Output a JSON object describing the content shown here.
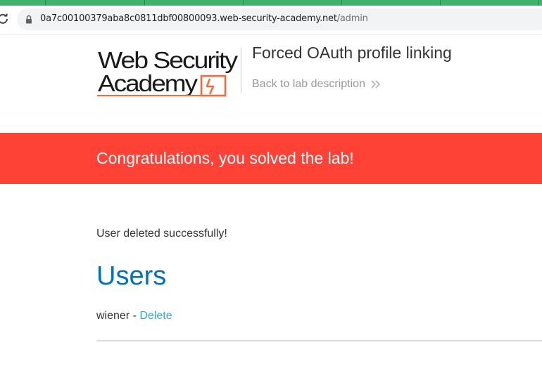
{
  "browser": {
    "url_host": "0a7c00100379aba8c0811dbf00800093.web-security-academy.net",
    "url_path": "/admin"
  },
  "header": {
    "logo_line1": "Web Security",
    "logo_line2": "Academy",
    "lab_title": "Forced OAuth profile linking",
    "back_link": "Back to lab description"
  },
  "banner": {
    "text": "Congratulations, you solved the lab!",
    "color": "#ff4136"
  },
  "main": {
    "message": "User deleted successfully!",
    "heading": "Users",
    "users": [
      {
        "name": "wiener",
        "separator": " - ",
        "action": "Delete"
      }
    ]
  },
  "colors": {
    "accent_blue": "#0071bc",
    "link": "#29abe0",
    "tabstrip": "#3db36b"
  }
}
